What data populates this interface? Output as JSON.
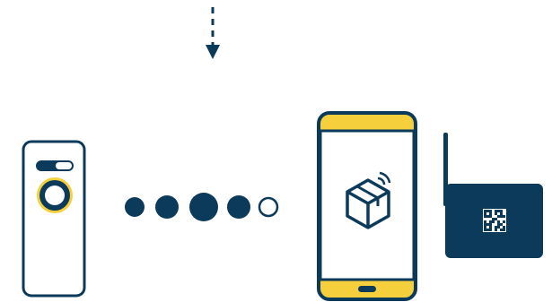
{
  "colors": {
    "navy": "#0b3a5b",
    "yellow": "#f5cf3c",
    "white": "#ffffff"
  },
  "icons": {
    "arrow": "dashed-down-arrow-icon",
    "remote": "remote-control-icon",
    "phone": "smartphone-icon",
    "package": "package-wireless-icon",
    "gateway": "gateway-device-icon",
    "qr": "qr-code-icon"
  },
  "transfer_dots": [
    {
      "filled": true
    },
    {
      "filled": true
    },
    {
      "filled": true
    },
    {
      "filled": true
    },
    {
      "filled": false
    }
  ]
}
